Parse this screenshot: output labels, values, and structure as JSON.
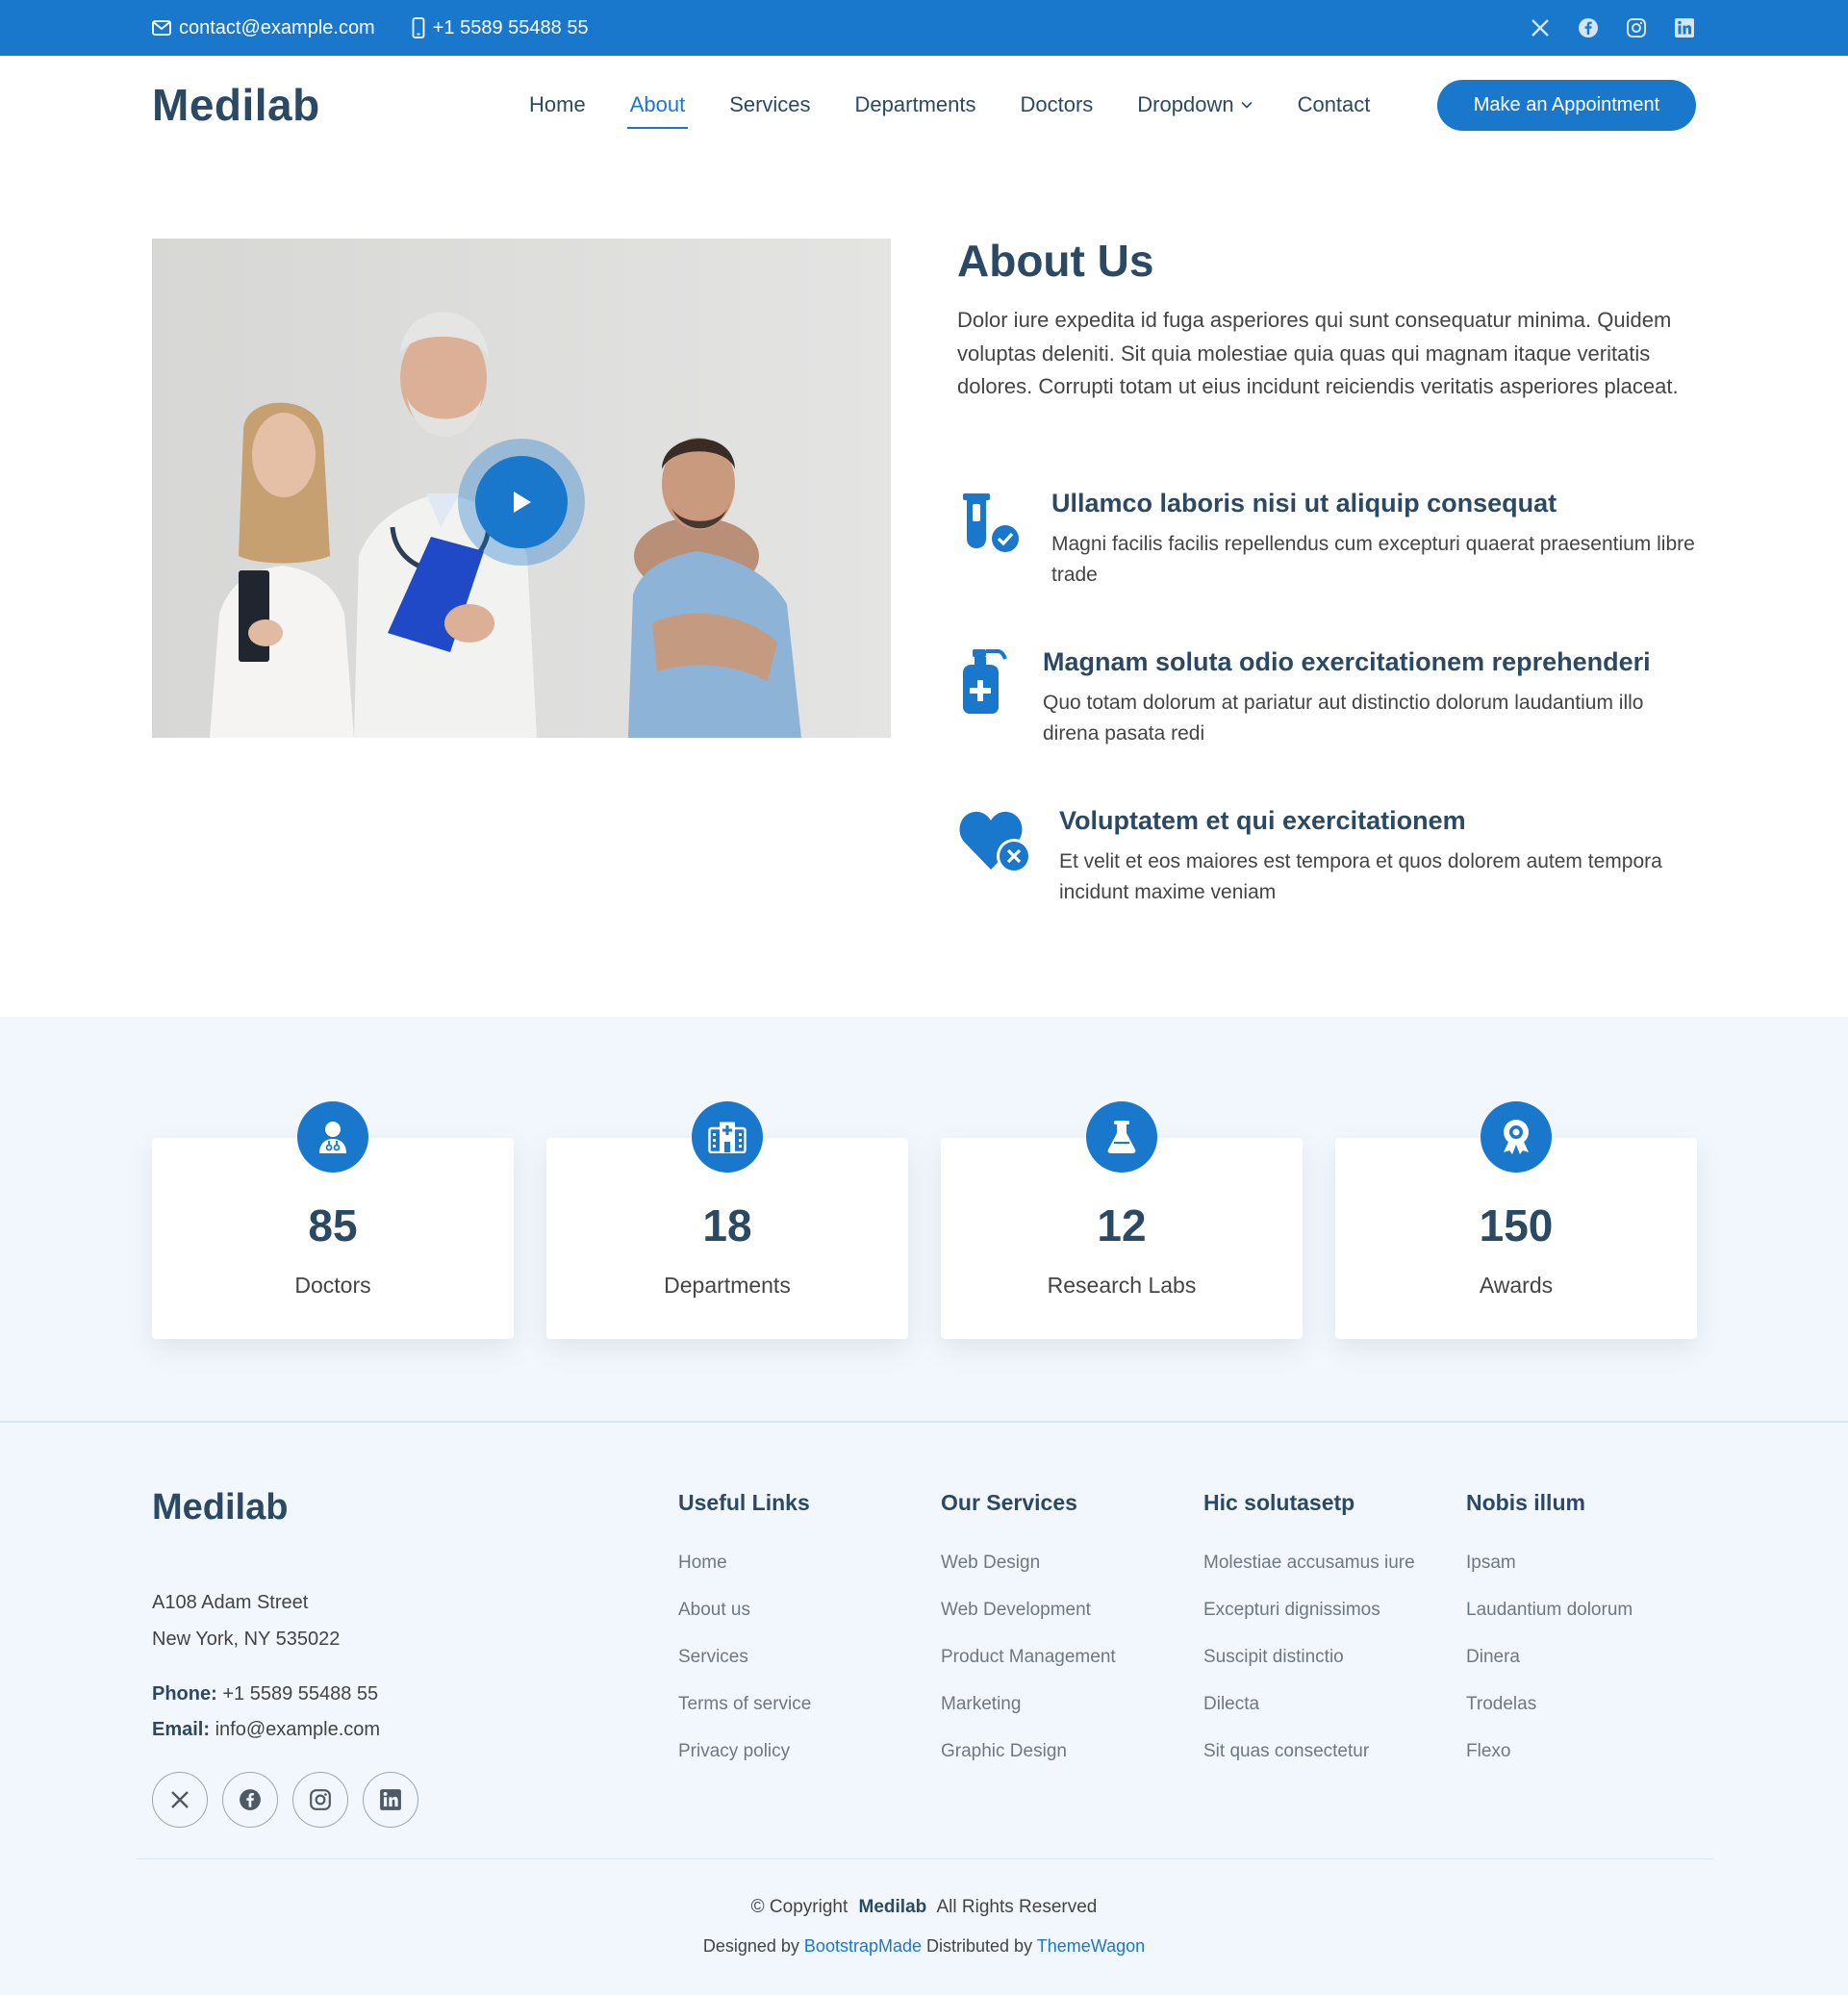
{
  "colors": {
    "accent": "#1977cc",
    "heading": "#2c4964",
    "text": "#444444",
    "light_bg": "#f1f7fd"
  },
  "topbar": {
    "email": "contact@example.com",
    "phone": "+1 5589 55488 55",
    "social_icons": [
      "x-icon",
      "facebook-icon",
      "instagram-icon",
      "linkedin-icon"
    ]
  },
  "header": {
    "logo": "Medilab",
    "nav": [
      "Home",
      "About",
      "Services",
      "Departments",
      "Doctors",
      "Dropdown",
      "Contact"
    ],
    "active_nav": "About",
    "cta": "Make an Appointment"
  },
  "about": {
    "title": "About Us",
    "description": "Dolor iure expedita id fuga asperiores qui sunt consequatur minima. Quidem voluptas deleniti. Sit quia molestiae quia quas qui magnam itaque veritatis dolores. Corrupti totam ut eius incidunt reiciendis veritatis asperiores placeat.",
    "features": [
      {
        "icon": "test-tube-check-icon",
        "title": "Ullamco laboris nisi ut aliquip consequat",
        "text": "Magni facilis facilis repellendus cum excepturi quaerat praesentium libre trade"
      },
      {
        "icon": "hand-sanitizer-icon",
        "title": "Magnam soluta odio exercitationem reprehenderi",
        "text": "Quo totam dolorum at pariatur aut distinctio dolorum laudantium illo direna pasata redi"
      },
      {
        "icon": "heart-x-icon",
        "title": "Voluptatem et qui exercitationem",
        "text": "Et velit et eos maiores est tempora et quos dolorem autem tempora incidunt maxime veniam"
      }
    ]
  },
  "stats": [
    {
      "icon": "doctor-icon",
      "value": "85",
      "label": "Doctors"
    },
    {
      "icon": "hospital-icon",
      "value": "18",
      "label": "Departments"
    },
    {
      "icon": "flask-icon",
      "value": "12",
      "label": "Research Labs"
    },
    {
      "icon": "award-icon",
      "value": "150",
      "label": "Awards"
    }
  ],
  "footer": {
    "logo": "Medilab",
    "address_line1": "A108 Adam Street",
    "address_line2": "New York, NY 535022",
    "phone_label": "Phone:",
    "phone": "+1 5589 55488 55",
    "email_label": "Email:",
    "email": "info@example.com",
    "columns": [
      {
        "title": "Useful Links",
        "links": [
          "Home",
          "About us",
          "Services",
          "Terms of service",
          "Privacy policy"
        ]
      },
      {
        "title": "Our Services",
        "links": [
          "Web Design",
          "Web Development",
          "Product Management",
          "Marketing",
          "Graphic Design"
        ]
      },
      {
        "title": "Hic solutasetp",
        "links": [
          "Molestiae accusamus iure",
          "Excepturi dignissimos",
          "Suscipit distinctio",
          "Dilecta",
          "Sit quas consectetur"
        ]
      },
      {
        "title": "Nobis illum",
        "links": [
          "Ipsam",
          "Laudantium dolorum",
          "Dinera",
          "Trodelas",
          "Flexo"
        ]
      }
    ],
    "copyright_prefix": "© Copyright",
    "copyright_brand": "Medilab",
    "copyright_suffix": "All Rights Reserved",
    "designed_by": "Designed by",
    "designer": "BootstrapMade",
    "distributed_by": "Distributed by",
    "distributor": "ThemeWagon"
  }
}
